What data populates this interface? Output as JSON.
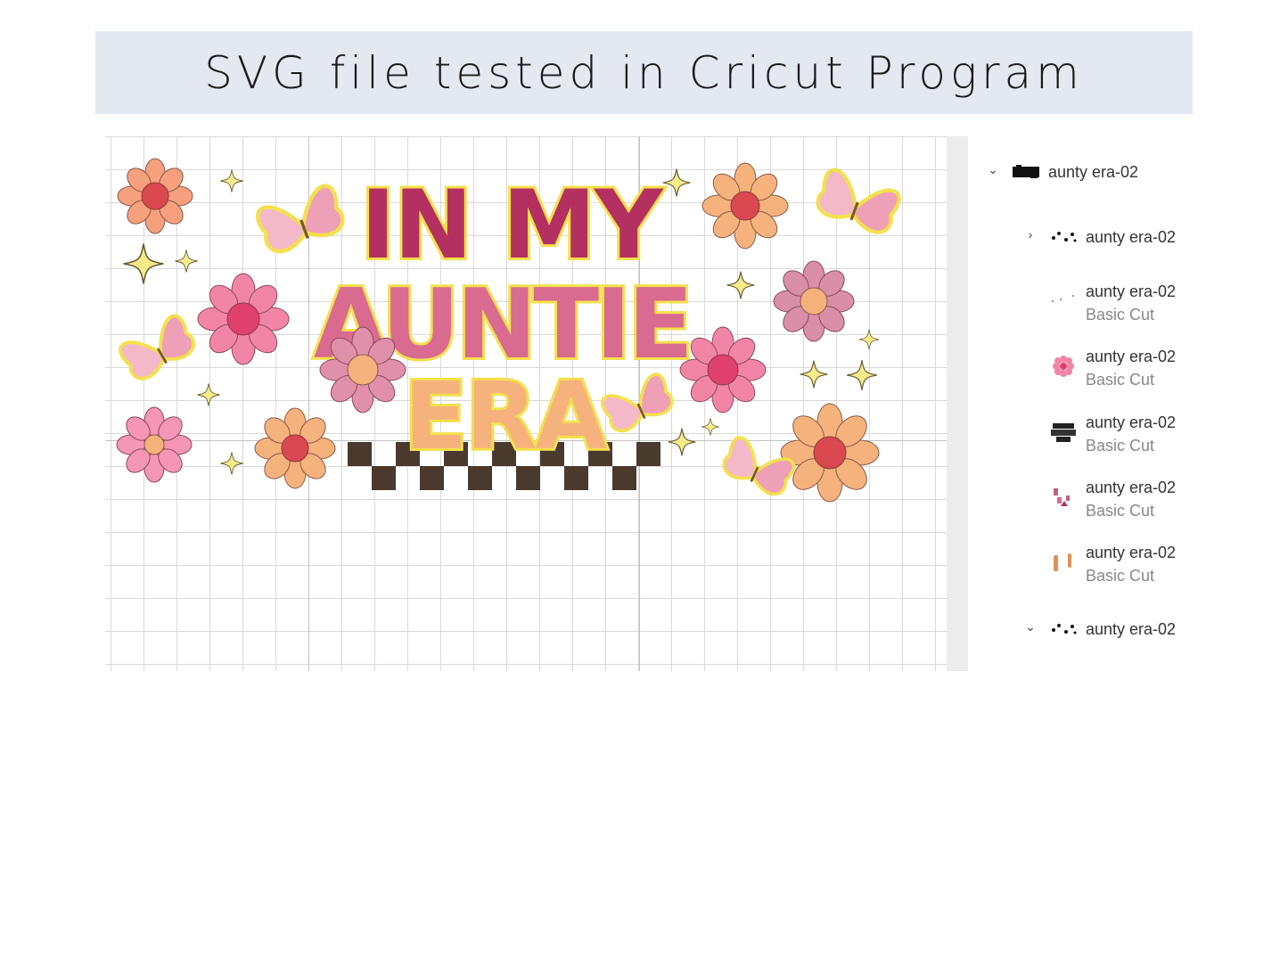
{
  "banner": {
    "title": "SVG file tested in Cricut Program"
  },
  "artwork": {
    "line1": "IN MY",
    "line2": "AUNTIE",
    "line3": "ERA"
  },
  "layers": [
    {
      "name": "aunty era-02",
      "sub": "",
      "expand": "chevron-down",
      "thumb": "group-black"
    },
    {
      "name": "aunty era-02",
      "sub": "",
      "expand": "chevron-right",
      "thumb": "dots"
    },
    {
      "name": "aunty era-02",
      "sub": "Basic Cut",
      "expand": "",
      "thumb": "tiny-dots"
    },
    {
      "name": "aunty era-02",
      "sub": "Basic Cut",
      "expand": "",
      "thumb": "pink-flower"
    },
    {
      "name": "aunty era-02",
      "sub": "Basic Cut",
      "expand": "",
      "thumb": "black-text"
    },
    {
      "name": "aunty era-02",
      "sub": "Basic Cut",
      "expand": "",
      "thumb": "pink-bits"
    },
    {
      "name": "aunty era-02",
      "sub": "Basic Cut",
      "expand": "",
      "thumb": "orange-bits"
    },
    {
      "name": "aunty era-02",
      "sub": "",
      "expand": "chevron-down",
      "thumb": "dots"
    }
  ],
  "colors": {
    "banner_bg": "#e3e8f1",
    "pink": "#e0557e",
    "rose": "#d98fa8",
    "peach": "#f6b27c",
    "outline_yellow": "#f4e04d",
    "check": "#4a3a2e"
  }
}
